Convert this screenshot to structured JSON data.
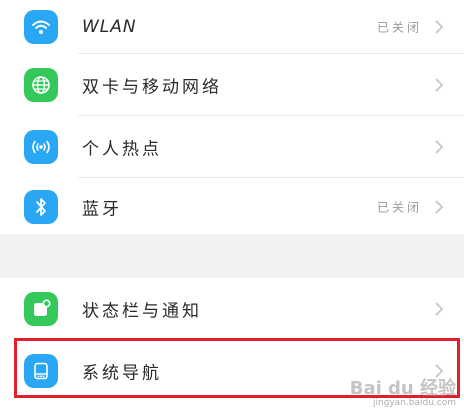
{
  "settings": {
    "rows": [
      {
        "label": "WLAN",
        "value": "已关闭",
        "icon": "wifi-icon",
        "color": "#2aa7f4"
      },
      {
        "label": "双卡与移动网络",
        "value": "",
        "icon": "globe-icon",
        "color": "#34c759"
      },
      {
        "label": "个人热点",
        "value": "",
        "icon": "hotspot-icon",
        "color": "#2aa7f4"
      },
      {
        "label": "蓝牙",
        "value": "已关闭",
        "icon": "bluetooth-icon",
        "color": "#2aa7f4"
      },
      {
        "label": "状态栏与通知",
        "value": "",
        "icon": "notification-icon",
        "color": "#34c759"
      },
      {
        "label": "系统导航",
        "value": "",
        "icon": "navigation-icon",
        "color": "#2aa7f4"
      }
    ]
  },
  "watermark": {
    "brand": "Bai du 经验",
    "url": "jingyan.baidu.com"
  },
  "colors": {
    "highlight": "#e0202a",
    "accent_blue": "#2aa7f4",
    "accent_green": "#34c759"
  }
}
